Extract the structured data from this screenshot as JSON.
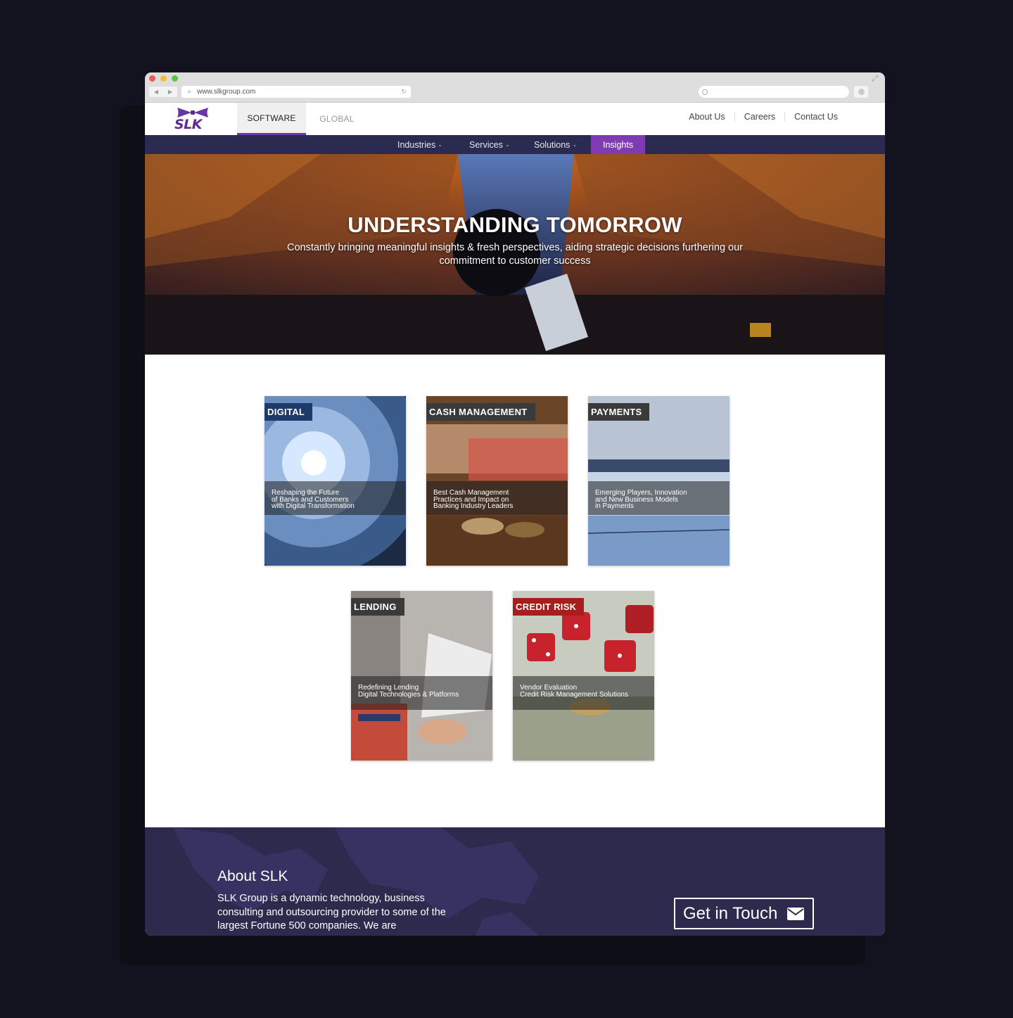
{
  "browser": {
    "url": "www.slkgroup.com"
  },
  "header": {
    "logo_text": "SLK",
    "tabs": [
      {
        "label": "SOFTWARE",
        "active": true
      },
      {
        "label": "GLOBAL",
        "active": false
      }
    ],
    "top_links": [
      "About Us",
      "Careers",
      "Contact Us"
    ]
  },
  "nav": {
    "items": [
      {
        "label": "Industries",
        "has_dropdown": true
      },
      {
        "label": "Services",
        "has_dropdown": true
      },
      {
        "label": "Solutions",
        "has_dropdown": true
      },
      {
        "label": "Insights",
        "active": true
      }
    ]
  },
  "hero": {
    "title": "UNDERSTANDING TOMORROW",
    "subtitle": "Constantly bringing meaningful insights & fresh perspectives, aiding strategic decisions furthering our commitment to customer success"
  },
  "cards": [
    {
      "label": "DIGITAL",
      "label_color": "#1e3a6b",
      "caption": "Reshaping the Future\nof Banks and Customers\nwith Digital Transformation"
    },
    {
      "label": "CASH MANAGEMENT",
      "label_color": "#3a3a3a",
      "caption": "Best Cash Management\nPractices and Impact on\nBanking Industry Leaders"
    },
    {
      "label": "PAYMENTS",
      "label_color": "#3a3a3a",
      "caption": "Emerging Players, Innovation\nand New Business Models\nin Payments"
    },
    {
      "label": "LENDING",
      "label_color": "#3a3a3a",
      "caption": "Redefining Lending\nDigital Technologies & Platforms"
    },
    {
      "label": "CREDIT RISK",
      "label_color": "#a81d1d",
      "caption": "Vendor Evaluation\nCredit Risk Management Solutions"
    }
  ],
  "footer": {
    "about_heading": "About SLK",
    "about_text": "SLK Group is a dynamic technology, business consulting and outsourcing provider to some of the largest Fortune 500 companies. We are",
    "cta_label": "Get in Touch"
  },
  "colors": {
    "brand_purple": "#5d2a8f",
    "nav_bg": "#2b2a50",
    "insights_active": "#7f3bb2",
    "footer_bg": "#2d2a4e"
  }
}
